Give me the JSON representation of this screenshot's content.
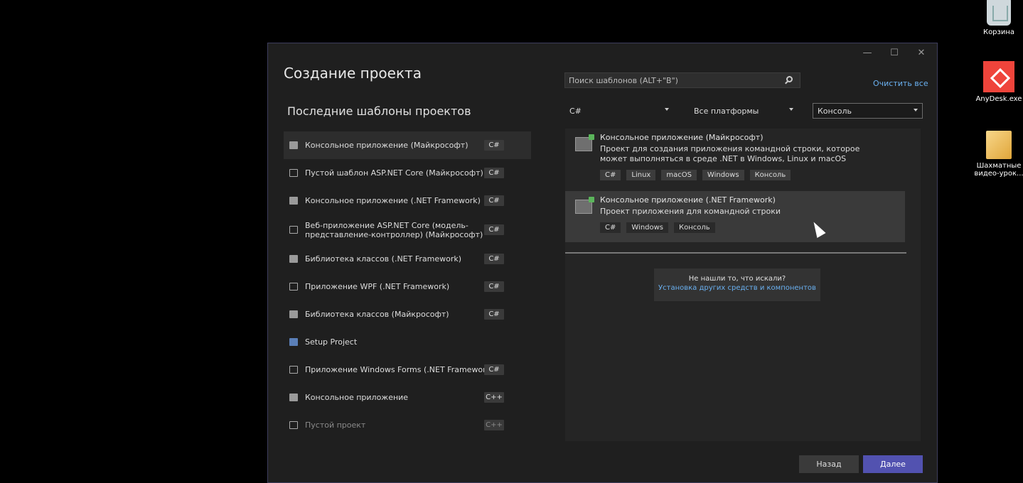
{
  "desktop": {
    "icons": [
      {
        "label": "Корзина",
        "icon": "recycle-bin-icon"
      },
      {
        "label": "AnyDesk.exe",
        "icon": "anydesk-icon"
      },
      {
        "label": "Шахматные видео-урок...",
        "icon": "file-icon"
      }
    ]
  },
  "dialog": {
    "title": "Создание проекта",
    "recent_title": "Последние шаблоны проектов",
    "recent": [
      {
        "label": "Консольное приложение (Майкрософт)",
        "lang": "C#"
      },
      {
        "label": "Пустой шаблон ASP.NET Core (Майкрософт)",
        "lang": "C#"
      },
      {
        "label": "Консольное приложение (.NET Framework)",
        "lang": "C#"
      },
      {
        "label": "Веб-приложение ASP.NET Core (модель-представление-контроллер) (Майкрософт)",
        "lang": "C#"
      },
      {
        "label": "Библиотека классов (.NET Framework)",
        "lang": "C#"
      },
      {
        "label": "Приложение WPF (.NET Framework)",
        "lang": "C#"
      },
      {
        "label": "Библиотека классов (Майкрософт)",
        "lang": "C#"
      },
      {
        "label": "Setup Project",
        "lang": ""
      },
      {
        "label": "Приложение Windows Forms (.NET Framework)",
        "lang": "C#"
      },
      {
        "label": "Консольное приложение",
        "lang": "C++"
      },
      {
        "label": "Пустой проект",
        "lang": "C++"
      }
    ],
    "search_placeholder": "Поиск шаблонов (ALT+\"В\")",
    "clear_all": "Очистить все",
    "filters": {
      "language": "C#",
      "platform": "Все платформы",
      "type": "Консоль"
    },
    "results": [
      {
        "title": "Консольное приложение (Майкрософт)",
        "desc": "Проект для создания приложения командной строки, которое может выполняться в среде .NET в Windows, Linux и macOS",
        "tags": [
          "C#",
          "Linux",
          "macOS",
          "Windows",
          "Консоль"
        ]
      },
      {
        "title": "Консольное приложение (.NET Framework)",
        "desc": "Проект приложения для командной строки",
        "tags": [
          "C#",
          "Windows",
          "Консоль"
        ]
      }
    ],
    "notfound": {
      "question": "Не нашли то, что искали?",
      "link": "Установка других средств и компонентов"
    },
    "buttons": {
      "back": "Назад",
      "next": "Далее"
    }
  }
}
